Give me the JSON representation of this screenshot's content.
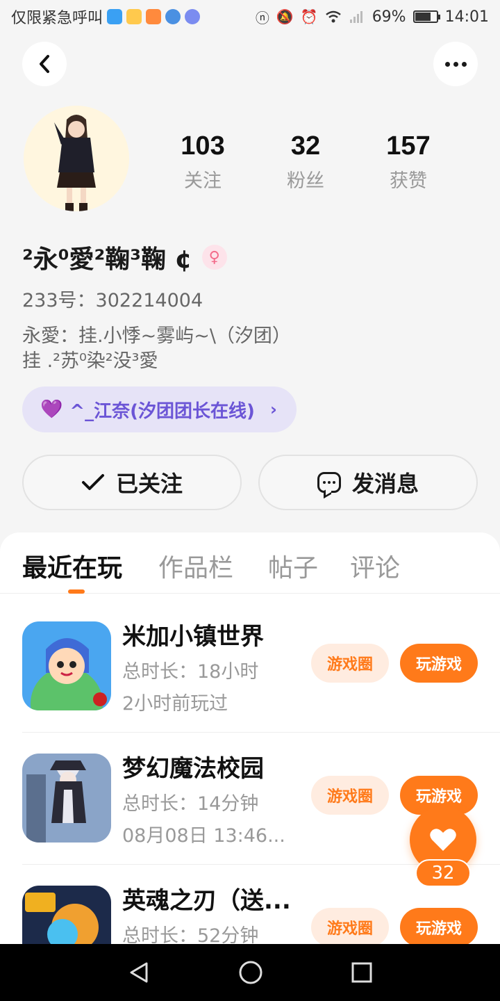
{
  "status_bar": {
    "carrier": "仅限紧急呼叫",
    "battery": "69%",
    "time": "14:01"
  },
  "profile": {
    "stats": [
      {
        "value": "103",
        "label": "关注"
      },
      {
        "value": "32",
        "label": "粉丝"
      },
      {
        "value": "157",
        "label": "获赞"
      }
    ],
    "username": "²永⁰愛²鞠³鞠 ¢",
    "gender_symbol": "♀",
    "uid": "233号：302214004",
    "bio_line1": "永愛：挂.小悸~雾屿~\\（汐团）",
    "bio_line2": "挂 .²苏⁰染²没³愛",
    "club_label": "^_江奈(汐团团长在线)",
    "follow_label": "已关注",
    "message_label": "发消息"
  },
  "tabs": [
    "最近在玩",
    "作品栏",
    "帖子",
    "评论"
  ],
  "games": [
    {
      "name": "米加小镇世界",
      "line1": "总时长：18小时",
      "line2": "2小时前玩过",
      "circle_label": "游戏圈",
      "play_label": "玩游戏"
    },
    {
      "name": "梦幻魔法校园",
      "line1": "总时长：14分钟",
      "line2": "08月08日 13:46...",
      "circle_label": "游戏圈",
      "play_label": "玩游戏"
    },
    {
      "name": "英魂之刃（送...",
      "line1": "总时长：52分钟",
      "line2": "",
      "circle_label": "游戏圈",
      "play_label": "玩游戏"
    }
  ],
  "like_count": "32",
  "colors": {
    "accent": "#ff7a1a",
    "club": "#6b55d6",
    "club_bg": "#e6e3f7"
  }
}
